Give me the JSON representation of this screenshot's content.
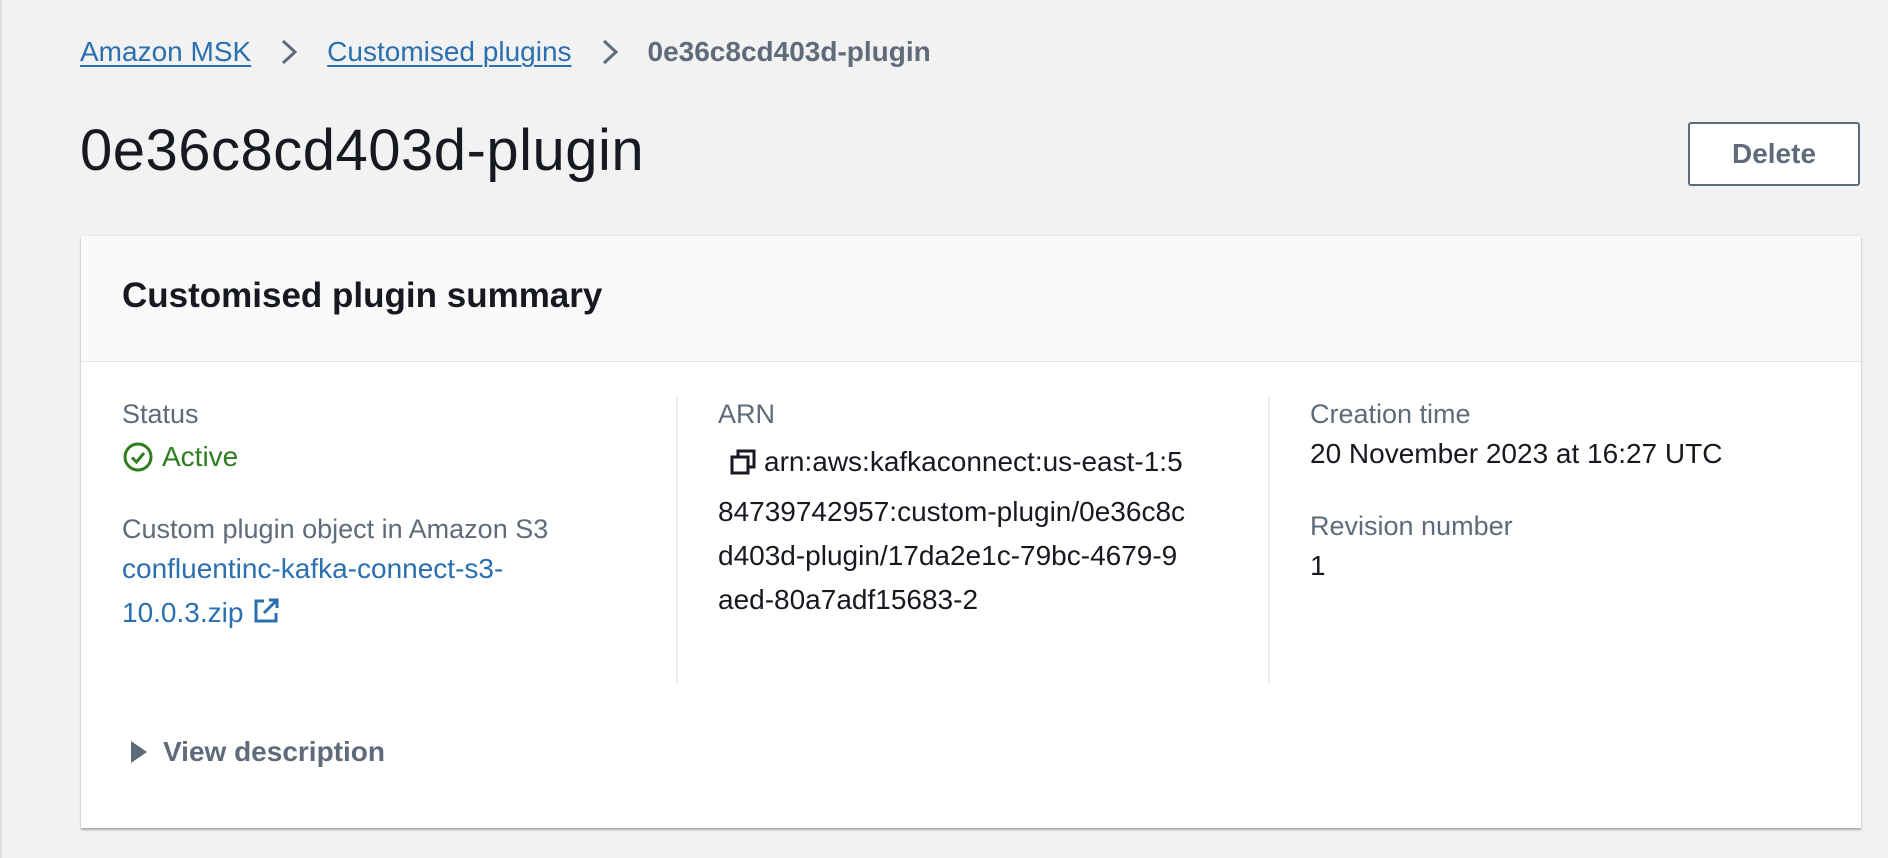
{
  "breadcrumb": {
    "items": [
      {
        "label": "Amazon MSK"
      },
      {
        "label": "Customised plugins"
      }
    ],
    "current": "0e36c8cd403d-plugin"
  },
  "page": {
    "title": "0e36c8cd403d-plugin",
    "delete_label": "Delete"
  },
  "summary": {
    "title": "Customised plugin summary",
    "status_label": "Status",
    "status_value": "Active",
    "s3_label": "Custom plugin object in Amazon S3",
    "s3_link": "confluentinc-kafka-connect-s3-10.0.3.zip",
    "arn_label": "ARN",
    "arn_value": "arn:aws:kafkaconnect:us-east-1:584739742957:custom-plugin/0e36c8cd403d-plugin/17da2e1c-79bc-4679-9aed-80a7adf15683-2",
    "creation_label": "Creation time",
    "creation_value": "20 November 2023 at 16:27 UTC",
    "revision_label": "Revision number",
    "revision_value": "1",
    "view_description": "View description"
  },
  "colors": {
    "link": "#2a6fb0",
    "success": "#2e7d1f",
    "secondary_text": "#5f6b7a"
  },
  "icons": [
    "chevron-right-icon",
    "status-check-icon",
    "external-link-icon",
    "copy-icon",
    "caret-right-icon"
  ]
}
